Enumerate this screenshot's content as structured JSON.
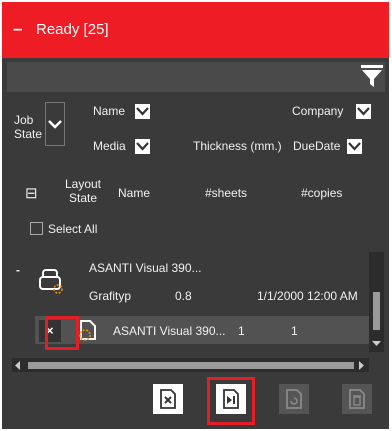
{
  "header": {
    "collapse_symbol": "–",
    "title": "Ready [25]",
    "accent_color": "#ee1c25"
  },
  "filter": {
    "icon": "funnel-filter-icon"
  },
  "columns_row1": {
    "job_state": "Job State",
    "name": "Name",
    "company": "Company",
    "media": "Media",
    "thickness": "Thickness (mm.)",
    "due_date": "DueDate"
  },
  "columns_row2": {
    "collapse_symbol": "⊟",
    "layout_state": "Layout State",
    "name": "Name",
    "sheets": "#sheets",
    "copies": "#copies",
    "select_all": "Select All"
  },
  "group": {
    "expander": "-",
    "name": "ASANTI Visual 390...",
    "company": "Grafityp",
    "thickness": "0.8",
    "due_date": "1/1/2000 12:00 AM"
  },
  "job": {
    "remove_symbol": "×",
    "name": "ASANTI Visual 390...",
    "sheets": "1",
    "copies": "1"
  },
  "toolbar": {
    "buttons": [
      {
        "icon": "remove-document-icon",
        "enabled": true
      },
      {
        "icon": "skip-to-end-icon",
        "enabled": true
      },
      {
        "icon": "reprocess-document-icon",
        "enabled": false
      },
      {
        "icon": "delete-trash-icon",
        "enabled": false
      }
    ]
  }
}
